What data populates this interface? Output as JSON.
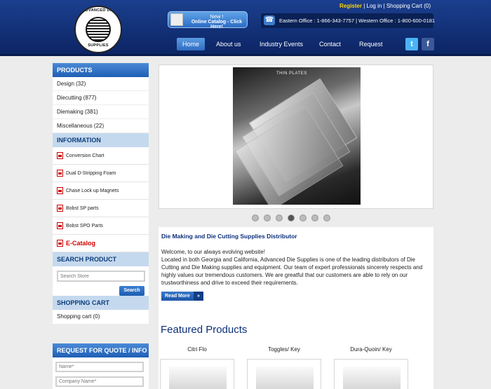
{
  "header": {
    "logo": {
      "top_text": "ADVANCED DIE",
      "bottom_text": "SUPPLIES"
    },
    "catalog_button": {
      "line1": "New !",
      "line2": "Online Catalog - Click Here!"
    },
    "top_links": {
      "register": "Register",
      "sep1": " | ",
      "login": "Log in",
      "sep2": " | ",
      "cart": "Shopping Cart (0)"
    },
    "office_info": "Eastern Office : 1-866-343-7757 | Western Office : 1-800-600-0181",
    "nav": [
      {
        "label": "Home",
        "active": true
      },
      {
        "label": "About us"
      },
      {
        "label": "Industry Events"
      },
      {
        "label": "Contact"
      },
      {
        "label": "Request"
      }
    ],
    "social": {
      "twitter": "t",
      "facebook": "f"
    }
  },
  "sidebar": {
    "products_title": "PRODUCTS",
    "products": [
      "Design (32)",
      "Diecutting (877)",
      "Diemaking (381)",
      "Miscellaneous (22)"
    ],
    "information_title": "INFORMATION",
    "information": [
      "Conversion Chart",
      "Dual D-Stripping Foam",
      "Chase Lock up Magnets",
      "Bobst SP parts",
      "Bobst SPO Parts"
    ],
    "ecatalog": "E-Catalog",
    "search_title": "SEARCH PRODUCT",
    "search_placeholder": "Search Store",
    "search_button": "Search",
    "cart_title": "SHOPPING CART",
    "cart_text": "Shopping cart  (0)",
    "quote_title": "REQUEST FOR QUOTE / INFO",
    "quote_name_placeholder": "Name*",
    "quote_company_placeholder": "Company Name*"
  },
  "slider": {
    "caption": "THIN PLATES",
    "dots": 7,
    "active_dot": 4
  },
  "content": {
    "title": "Die Making and Die Cutting Supplies Distributor",
    "welcome": "Welcome,  to our always evolving website!",
    "body": "Located in both Georgia and California, Advanced Die Supplies is one of the leading distributors of Die Cutting and Die Making supplies and equipment. Our team of expert professionals sincerely respects and highly values our tremendous customers. We are greatful that our customers are able to rely on our trustworthiness and drive to exceed their requirements.",
    "read_more": "Read More",
    "featured_title": "Featured Products",
    "products": [
      "Citri Flo",
      "Toggles/ Key",
      "Dura-Quoin/ Key"
    ]
  }
}
